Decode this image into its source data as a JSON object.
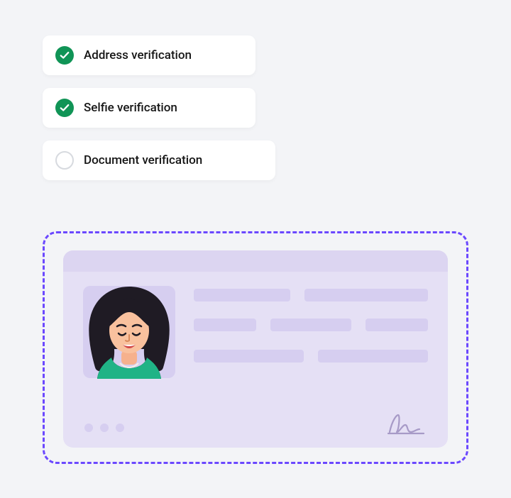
{
  "steps": [
    {
      "label": "Address verification",
      "status": "done"
    },
    {
      "label": "Selfie verification",
      "status": "done"
    },
    {
      "label": "Document verification",
      "status": "pending"
    }
  ],
  "icons": {
    "check": "check-icon",
    "ring": "empty-circle-icon",
    "avatar": "avatar-illustration",
    "signature": "signature-icon"
  },
  "colors": {
    "accent": "#6b48ff",
    "success": "#109456",
    "cardBg": "#e5e0f5",
    "fieldBg": "#d6cef0"
  },
  "document": {
    "type": "id-card",
    "photo_present": true,
    "field_rows": 3,
    "dots": 3,
    "signature_present": true
  }
}
